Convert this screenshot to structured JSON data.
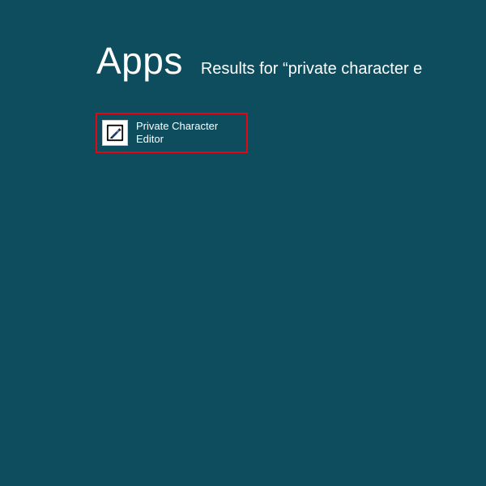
{
  "header": {
    "title": "Apps",
    "subtitle": "Results for “private character e"
  },
  "results": [
    {
      "label": "Private Character Editor",
      "icon": "eudcedit-icon"
    }
  ]
}
